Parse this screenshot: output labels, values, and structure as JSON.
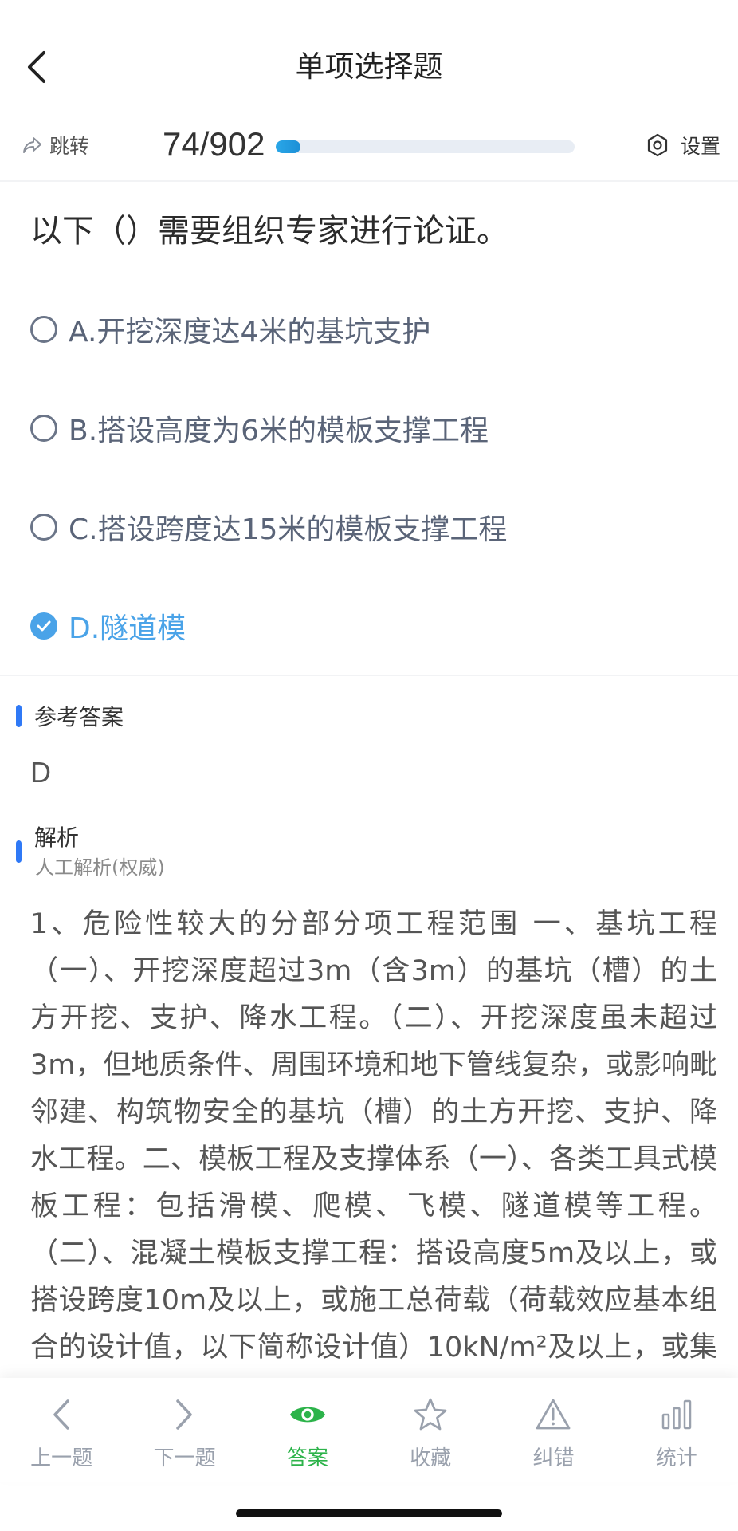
{
  "header": {
    "title": "单项选择题"
  },
  "progress": {
    "jump_label": "跳转",
    "counter": "74/902",
    "fraction": 0.082,
    "settings_label": "设置"
  },
  "question": {
    "text": "以下（）需要组织专家进行论证。",
    "options": [
      {
        "label": "A.开挖深度达4米的基坑支护",
        "selected": false
      },
      {
        "label": "B.搭设高度为6米的模板支撑工程",
        "selected": false
      },
      {
        "label": "C.搭设跨度达15米的模板支撑工程",
        "selected": false
      },
      {
        "label": "D.隧道模",
        "selected": true
      }
    ]
  },
  "answer": {
    "title": "参考答案",
    "value": "D"
  },
  "analysis": {
    "title": "解析",
    "subtitle": "人工解析(权威)",
    "text": "1、危险性较大的分部分项工程范围 一、基坑工程（一）、开挖深度超过3m（含3m）的基坑（槽）的土方开挖、支护、降水工程。（二）、开挖深度虽未超过3m，但地质条件、周围环境和地下管线复杂，或影响毗邻建、构筑物安全的基坑（槽）的土方开挖、支护、降水工程。二、模板工程及支撑体系（一）、各类工具式模板工程：包括滑模、爬模、飞模、隧道模等工程。（二）、混凝土模板支撑工程：搭设高度5m及以上，或搭设跨度10m及以上，或施工总荷载（荷载效应基本组合的设计值，以下简称设计值）10kN/m²及以上，或集中线荷载"
  },
  "bottom_nav": {
    "items": [
      {
        "label": "上一题",
        "icon": "chevron-left-icon"
      },
      {
        "label": "下一题",
        "icon": "chevron-right-icon"
      },
      {
        "label": "答案",
        "icon": "eye-icon"
      },
      {
        "label": "收藏",
        "icon": "star-icon"
      },
      {
        "label": "纠错",
        "icon": "warning-icon"
      },
      {
        "label": "统计",
        "icon": "bar-chart-icon"
      }
    ],
    "active_index": 2
  },
  "colors": {
    "accent_blue": "#4aa3e8",
    "active_green": "#2cb34a",
    "section_bar": "#2f79f6"
  }
}
